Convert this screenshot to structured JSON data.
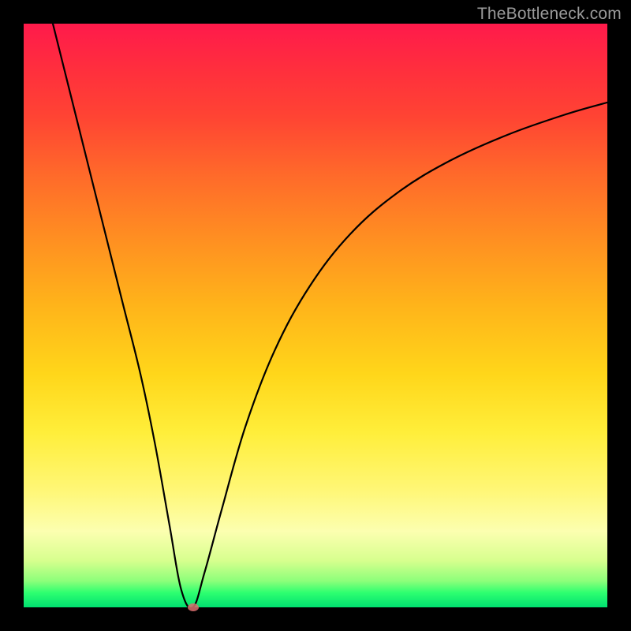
{
  "watermark": "TheBottleneck.com",
  "chart_data": {
    "type": "line",
    "title": "",
    "xlabel": "",
    "ylabel": "",
    "xlim": [
      0,
      100
    ],
    "ylim": [
      0,
      100
    ],
    "grid": false,
    "legend": false,
    "colors": {
      "gradient_top": "#ff1a4b",
      "gradient_bottom": "#00e070",
      "curve": "#000000",
      "frame": "#000000",
      "min_marker": "#dc6e6e"
    },
    "series": [
      {
        "name": "bottleneck-curve",
        "x": [
          5,
          8,
          11,
          14,
          17,
          20,
          22.5,
          25,
          27,
          29,
          31,
          34,
          38,
          43,
          49,
          56,
          64,
          73,
          83,
          93,
          100
        ],
        "values": [
          100,
          88,
          76,
          64,
          52,
          40,
          28,
          14,
          3,
          0,
          6,
          17,
          31,
          44,
          55,
          64,
          71,
          76.5,
          81,
          84.5,
          86.5
        ]
      }
    ],
    "annotations": [
      {
        "name": "min-point",
        "x": 29,
        "y": 0
      }
    ]
  }
}
